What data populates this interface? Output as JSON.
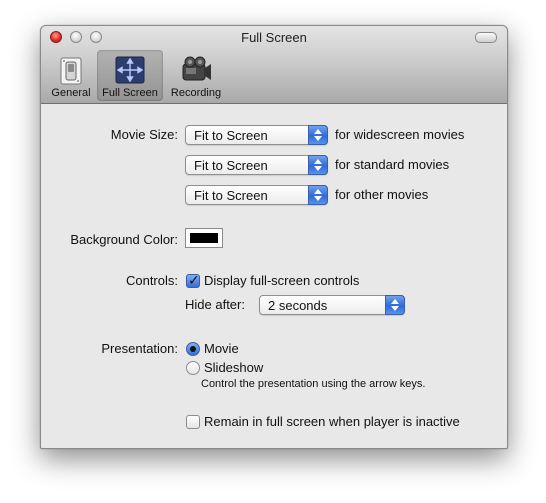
{
  "window": {
    "title": "Full Screen"
  },
  "toolbar": [
    {
      "label": "General",
      "icon": "switch-icon",
      "selected": false
    },
    {
      "label": "Full Screen",
      "icon": "fullscreen-icon",
      "selected": true
    },
    {
      "label": "Recording",
      "icon": "camera-icon",
      "selected": false
    }
  ],
  "movie_size": {
    "label": "Movie Size:",
    "rows": [
      {
        "value": "Fit to Screen",
        "suffix": "for widescreen movies"
      },
      {
        "value": "Fit to Screen",
        "suffix": "for standard movies"
      },
      {
        "value": "Fit to Screen",
        "suffix": "for other movies"
      }
    ]
  },
  "background_color": {
    "label": "Background Color:",
    "color": "#000000"
  },
  "controls": {
    "label": "Controls:",
    "display_checkbox": {
      "label": "Display full-screen controls",
      "checked": true
    },
    "hide_after": {
      "label": "Hide after:",
      "value": "2 seconds"
    }
  },
  "presentation": {
    "label": "Presentation:",
    "options": [
      {
        "label": "Movie",
        "selected": true
      },
      {
        "label": "Slideshow",
        "selected": false
      }
    ],
    "hint": "Control the presentation using the arrow keys."
  },
  "remain_checkbox": {
    "label": "Remain in full screen when player is inactive",
    "checked": false
  },
  "colors": {
    "accent": "#3a74dd",
    "window_bg": "#e8e8e8"
  }
}
